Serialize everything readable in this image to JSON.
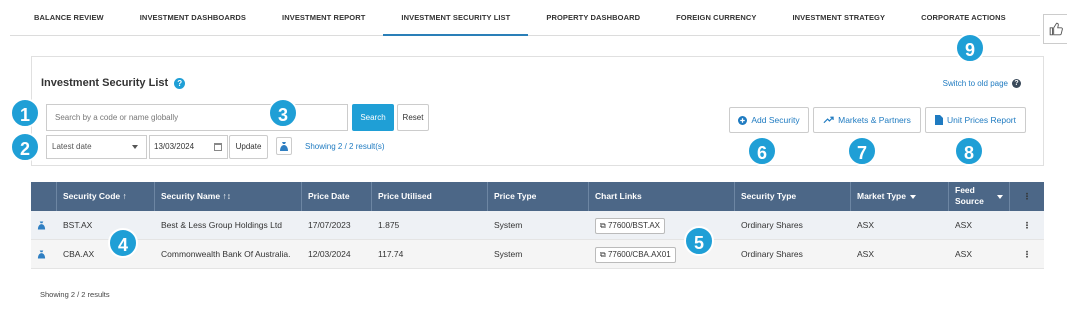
{
  "nav": {
    "tabs": [
      {
        "label": "BALANCE REVIEW"
      },
      {
        "label": "INVESTMENT DASHBOARDS"
      },
      {
        "label": "INVESTMENT REPORT"
      },
      {
        "label": "INVESTMENT SECURITY LIST"
      },
      {
        "label": "PROPERTY DASHBOARD"
      },
      {
        "label": "FOREIGN CURRENCY"
      },
      {
        "label": "INVESTMENT STRATEGY"
      },
      {
        "label": "CORPORATE ACTIONS"
      }
    ],
    "active_tab": "INVESTMENT SECURITY LIST"
  },
  "panel": {
    "title": "Investment Security List",
    "switch_link": "Switch to old page",
    "search_placeholder": "Search by a code or name globally",
    "search_button": "Search",
    "reset_button": "Reset",
    "date_select": "Latest date",
    "date_value": "13/03/2024",
    "update_button": "Update",
    "showing": "Showing 2 / 2 result(s)",
    "add_security": "Add Security",
    "markets_partners": "Markets & Partners",
    "unit_prices_report": "Unit Prices Report"
  },
  "badges": [
    "1",
    "2",
    "3",
    "4",
    "5",
    "6",
    "7",
    "8",
    "9"
  ],
  "table": {
    "headers": {
      "security_code": "Security Code",
      "security_name": "Security Name",
      "price_date": "Price Date",
      "price_utilised": "Price Utilised",
      "price_type": "Price Type",
      "chart_links": "Chart Links",
      "security_type": "Security Type",
      "market_type": "Market Type",
      "feed_source_1": "Feed",
      "feed_source_2": "Source"
    },
    "rows": [
      {
        "code": "BST.AX",
        "name": "Best & Less Group Holdings Ltd",
        "price_date": "17/07/2023",
        "price": "1.875",
        "price_type": "System",
        "chart_link": "77600/BST.AX",
        "security_type": "Ordinary Shares",
        "market": "ASX",
        "feed": "ASX"
      },
      {
        "code": "CBA.AX",
        "name": "Commonwealth Bank Of Australia.",
        "price_date": "12/03/2024",
        "price": "117.74",
        "price_type": "System",
        "chart_link": "77600/CBA.AX01",
        "security_type": "Ordinary Shares",
        "market": "ASX",
        "feed": "ASX"
      }
    ]
  },
  "footer": "Showing 2 / 2 results",
  "colors": {
    "accent": "#1f9fd6",
    "header_bg": "#4c6787",
    "link": "#1f7bc1"
  }
}
